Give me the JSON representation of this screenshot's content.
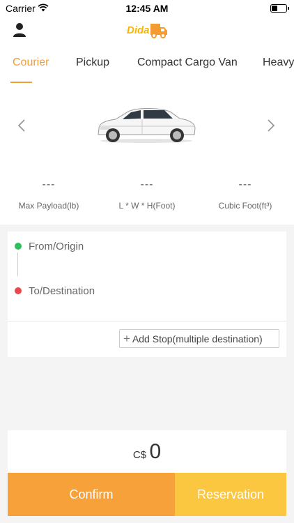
{
  "status_bar": {
    "carrier": "Carrier",
    "time": "12:45 AM",
    "battery_level": 0.4
  },
  "header": {
    "logo_text": "Dida"
  },
  "tabs": [
    {
      "label": "Courier",
      "active": true
    },
    {
      "label": "Pickup",
      "active": false
    },
    {
      "label": "Compact Cargo Van",
      "active": false
    },
    {
      "label": "Heavy",
      "active": false
    }
  ],
  "specs": [
    {
      "value": "---",
      "label": "Max Payload(lb)"
    },
    {
      "value": "---",
      "label": "L * W * H(Foot)"
    },
    {
      "value": "---",
      "label": "Cubic Foot(ft³)"
    }
  ],
  "route": {
    "origin_placeholder": "From/Origin",
    "destination_placeholder": "To/Destination",
    "add_stop_label": "Add Stop(multiple destination)"
  },
  "price": {
    "currency": "C$",
    "amount": "0"
  },
  "actions": {
    "confirm_label": "Confirm",
    "reservation_label": "Reservation"
  },
  "colors": {
    "accent": "#f39c33",
    "confirm": "#f7a13b",
    "reservation": "#fbc640",
    "origin_dot": "#2dbf5a",
    "destination_dot": "#e8484d"
  }
}
